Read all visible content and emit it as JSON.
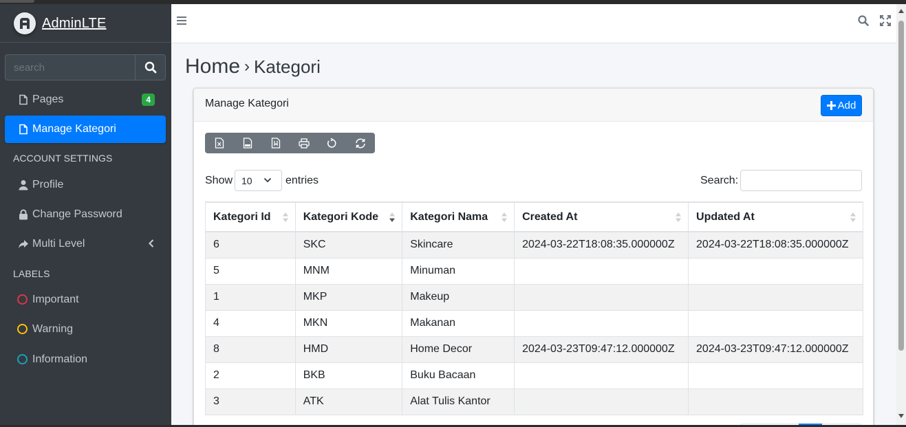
{
  "brand": {
    "name_bold": "Admin",
    "name_light": "LTE"
  },
  "sidebar": {
    "search_placeholder": "search",
    "items": [
      {
        "label": "Pages",
        "icon": "file-icon",
        "badge": "4"
      },
      {
        "label": "Manage Kategori",
        "icon": "file-icon",
        "active": true
      }
    ],
    "account_header": "ACCOUNT SETTINGS",
    "account_items": [
      {
        "label": "Profile",
        "icon": "user-icon"
      },
      {
        "label": "Change Password",
        "icon": "lock-icon"
      },
      {
        "label": "Multi Level",
        "icon": "share-icon"
      }
    ],
    "labels_header": "LABELS",
    "labels": [
      {
        "label": "Important",
        "color": "#dc3545"
      },
      {
        "label": "Warning",
        "color": "#ffc107"
      },
      {
        "label": "Information",
        "color": "#17a2b8"
      }
    ]
  },
  "page": {
    "title": "Home",
    "separator": "›",
    "subtitle": "Kategori"
  },
  "card": {
    "title": "Manage Kategori",
    "add_label": "Add",
    "toolbar_icons": [
      "excel-icon",
      "csv-icon",
      "pdf-icon",
      "print-icon",
      "reload-icon",
      "refresh-icon"
    ],
    "show_label": "Show",
    "entries_value": "10",
    "entries_label": "entries",
    "search_label": "Search:"
  },
  "table": {
    "columns": [
      "Kategori Id",
      "Kategori Kode",
      "Kategori Nama",
      "Created At",
      "Updated At"
    ],
    "rows": [
      [
        "6",
        "SKC",
        "Skincare",
        "2024-03-22T18:08:35.000000Z",
        "2024-03-22T18:08:35.000000Z"
      ],
      [
        "5",
        "MNM",
        "Minuman",
        "",
        ""
      ],
      [
        "1",
        "MKP",
        "Makeup",
        "",
        ""
      ],
      [
        "4",
        "MKN",
        "Makanan",
        "",
        ""
      ],
      [
        "8",
        "HMD",
        "Home Decor",
        "2024-03-23T09:47:12.000000Z",
        "2024-03-23T09:47:12.000000Z"
      ],
      [
        "2",
        "BKB",
        "Buku Bacaan",
        "",
        ""
      ],
      [
        "3",
        "ATK",
        "Alat Tulis Kantor",
        "",
        ""
      ]
    ]
  },
  "colors": {
    "accent": "#007bff",
    "sidebar_bg": "#343a40",
    "badge": "#28a745"
  }
}
